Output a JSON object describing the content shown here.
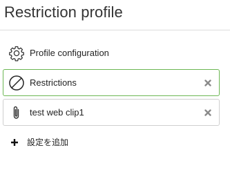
{
  "page": {
    "title": "Restriction profile"
  },
  "payloads": [
    {
      "label": "Profile configuration",
      "icon": "gear-icon",
      "removable": false,
      "selected": false
    },
    {
      "label": "Restrictions",
      "icon": "prohibited-icon",
      "removable": true,
      "selected": true
    },
    {
      "label": "test web clip1",
      "icon": "paperclip-icon",
      "removable": true,
      "selected": false
    }
  ],
  "add_setting": {
    "label": "設定を追加",
    "icon": "plus-icon"
  },
  "colors": {
    "selected_border": "#6bb652",
    "default_border": "#cfcfcf",
    "remove_icon": "#8a8a8a",
    "text": "#222222"
  }
}
